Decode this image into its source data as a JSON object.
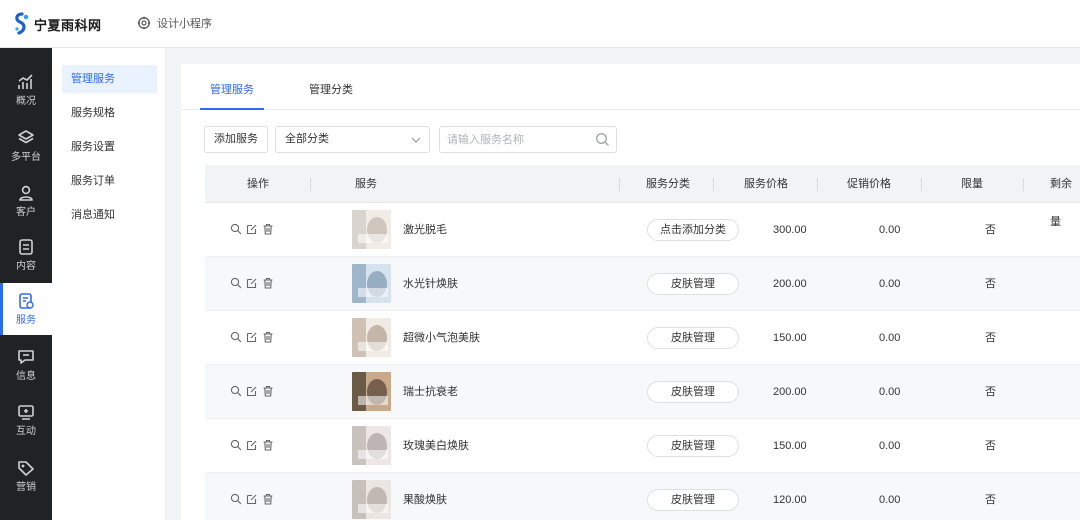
{
  "brand": {
    "name": "宁夏雨科网"
  },
  "topbar": {
    "design_link": "设计小程序"
  },
  "sidebar": {
    "items": [
      {
        "label": "概况",
        "icon": "chart-icon"
      },
      {
        "label": "多平台",
        "icon": "layers-icon"
      },
      {
        "label": "客户",
        "icon": "user-icon"
      },
      {
        "label": "内容",
        "icon": "document-icon"
      },
      {
        "label": "服务",
        "icon": "service-icon",
        "active": true
      },
      {
        "label": "信息",
        "icon": "message-icon"
      },
      {
        "label": "互动",
        "icon": "interact-icon"
      },
      {
        "label": "营销",
        "icon": "tag-icon"
      }
    ]
  },
  "subnav": {
    "items": [
      {
        "label": "管理服务",
        "active": true
      },
      {
        "label": "服务规格"
      },
      {
        "label": "服务设置"
      },
      {
        "label": "服务订单"
      },
      {
        "label": "消息通知"
      }
    ]
  },
  "tabs": [
    {
      "label": "管理服务",
      "active": true
    },
    {
      "label": "管理分类"
    }
  ],
  "toolbar": {
    "add_label": "添加服务",
    "category_select": "全部分类",
    "search_placeholder": "请输入服务名称"
  },
  "table": {
    "headers": [
      "操作",
      "服务",
      "服务分类",
      "服务价格",
      "促销价格",
      "限量",
      "剩余量"
    ],
    "rows": [
      {
        "name": "激光脱毛",
        "category": "点击添加分类",
        "price": "300.00",
        "promo": "0.00",
        "limit": "否"
      },
      {
        "name": "水光针焕肤",
        "category": "皮肤管理",
        "price": "200.00",
        "promo": "0.00",
        "limit": "否"
      },
      {
        "name": "超微小气泡美肤",
        "category": "皮肤管理",
        "price": "150.00",
        "promo": "0.00",
        "limit": "否"
      },
      {
        "name": "瑞士抗衰老",
        "category": "皮肤管理",
        "price": "200.00",
        "promo": "0.00",
        "limit": "否"
      },
      {
        "name": "玫瑰美白焕肤",
        "category": "皮肤管理",
        "price": "150.00",
        "promo": "0.00",
        "limit": "否"
      },
      {
        "name": "果酸焕肤",
        "category": "皮肤管理",
        "price": "120.00",
        "promo": "0.00",
        "limit": "否"
      }
    ]
  },
  "colors": {
    "accent": "#2f6bef",
    "sidebar_bg": "#202225"
  }
}
